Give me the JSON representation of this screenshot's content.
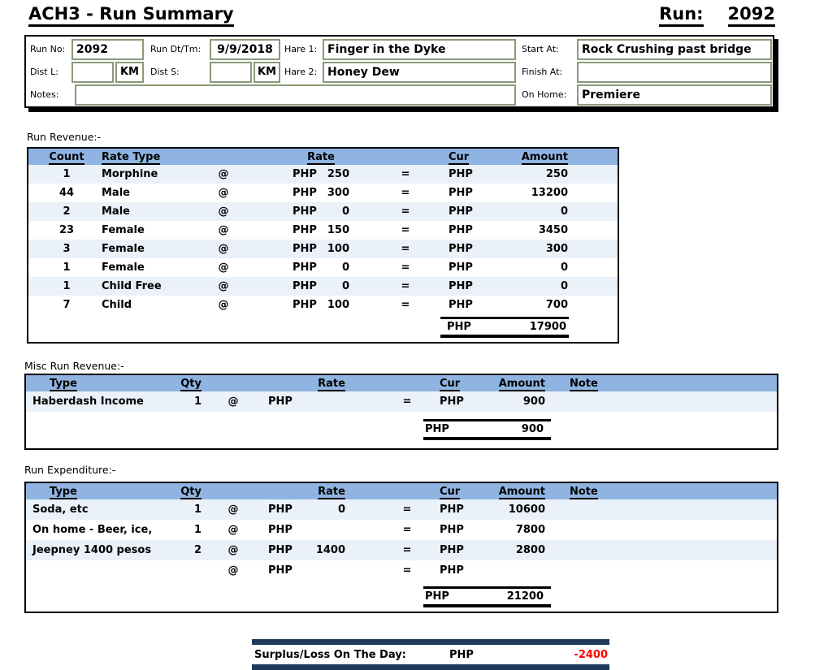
{
  "title": "ACH3 - Run Summary",
  "run_header": {
    "label": "Run:",
    "number": "2092"
  },
  "sym": {
    "php": "PHP",
    "at": "@",
    "eq": "="
  },
  "info": {
    "run_no": {
      "label": "Run No:",
      "value": "2092"
    },
    "run_dttm": {
      "label": "Run Dt/Tm:",
      "value": "9/9/2018"
    },
    "hare1": {
      "label": "Hare 1:",
      "value": "Finger in the Dyke"
    },
    "start_at": {
      "label": "Start At:",
      "value": "Rock Crushing past bridge"
    },
    "dist_l": {
      "label": "Dist L:",
      "value": "",
      "unit": "KM"
    },
    "dist_s": {
      "label": "Dist S:",
      "value": "",
      "unit": "KM"
    },
    "hare2": {
      "label": "Hare 2:",
      "value": "Honey Dew"
    },
    "finish_at": {
      "label": "Finish At:",
      "value": ""
    },
    "notes": {
      "label": "Notes:",
      "value": ""
    },
    "on_home": {
      "label": "On Home:",
      "value": "Premiere"
    }
  },
  "revenue": {
    "section_label": "Run Revenue:-",
    "headers": {
      "count": "Count",
      "rate_type": "Rate Type",
      "rate": "Rate",
      "cur": "Cur",
      "amount": "Amount"
    },
    "rows": [
      {
        "count": "1",
        "type": "Morphine",
        "rate": "250",
        "amount": "250"
      },
      {
        "count": "44",
        "type": "Male",
        "rate": "300",
        "amount": "13200"
      },
      {
        "count": "2",
        "type": "Male",
        "rate": "0",
        "amount": "0"
      },
      {
        "count": "23",
        "type": "Female",
        "rate": "150",
        "amount": "3450"
      },
      {
        "count": "3",
        "type": "Female",
        "rate": "100",
        "amount": "300"
      },
      {
        "count": "1",
        "type": "Female",
        "rate": "0",
        "amount": "0"
      },
      {
        "count": "1",
        "type": "Child Free",
        "rate": "0",
        "amount": "0"
      },
      {
        "count": "7",
        "type": "Child",
        "rate": "100",
        "amount": "700"
      }
    ],
    "total": {
      "cur": "PHP",
      "amount": "17900"
    }
  },
  "misc": {
    "section_label": "Misc Run Revenue:-",
    "headers": {
      "type": "Type",
      "qty": "Qty",
      "rate": "Rate",
      "cur": "Cur",
      "amount": "Amount",
      "note": "Note"
    },
    "rows": [
      {
        "type": "Haberdash Income",
        "qty": "1",
        "rate": "",
        "amount": "900",
        "note": ""
      }
    ],
    "total": {
      "cur": "PHP",
      "amount": "900"
    }
  },
  "expenditure": {
    "section_label": "Run Expenditure:-",
    "headers": {
      "type": "Type",
      "qty": "Qty",
      "rate": "Rate",
      "cur": "Cur",
      "amount": "Amount",
      "note": "Note"
    },
    "rows": [
      {
        "type": "Soda, etc",
        "qty": "1",
        "rate": "0",
        "amount": "10600",
        "note": ""
      },
      {
        "type": "On home - Beer, ice,",
        "qty": "1",
        "rate": "",
        "amount": "7800",
        "note": ""
      },
      {
        "type": "Jeepney 1400 pesos",
        "qty": "2",
        "rate": "1400",
        "amount": "2800",
        "note": ""
      },
      {
        "type": "",
        "qty": "",
        "rate": "",
        "amount": "",
        "note": ""
      }
    ],
    "total": {
      "cur": "PHP",
      "amount": "21200"
    }
  },
  "surplus": {
    "label": "Surplus/Loss On The Day:",
    "cur": "PHP",
    "amount": "-2400"
  },
  "colors": {
    "header_band": "#8fb4e1",
    "row_alt": "#eaf1f9",
    "input_border": "#8a9a78",
    "bar": "#1f3a5c",
    "negative": "#ff0000"
  }
}
